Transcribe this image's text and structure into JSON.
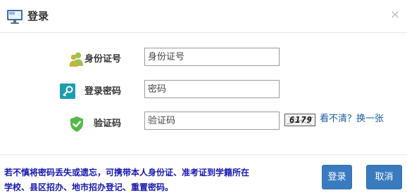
{
  "header": {
    "title": "登录",
    "close_glyph": "×",
    "icon": "monitor-icon"
  },
  "form": {
    "id_number": {
      "label": "身份证号",
      "placeholder": "身份证号",
      "icon": "users-icon",
      "icon_color": "#8ab83c"
    },
    "password": {
      "label": "登录密码",
      "placeholder": "密码",
      "icon": "key-icon",
      "icon_color": "#1e9db0"
    },
    "captcha": {
      "label": "验证码",
      "placeholder": "验证码",
      "icon": "shield-check-icon",
      "icon_color": "#56b84a",
      "image_text": "6179",
      "refresh_link": "看不清？换一张"
    }
  },
  "footer": {
    "notice_line1": "若不慎将密码丢失或遗忘，可携带本人身份证、准考证到学籍所在",
    "notice_line2": "学校、县区招办、地市招办登记、重置密码。",
    "notice_color": "#1515b0",
    "login_button": "登录",
    "cancel_button": "取消",
    "button_color": "#3a7bc0"
  }
}
